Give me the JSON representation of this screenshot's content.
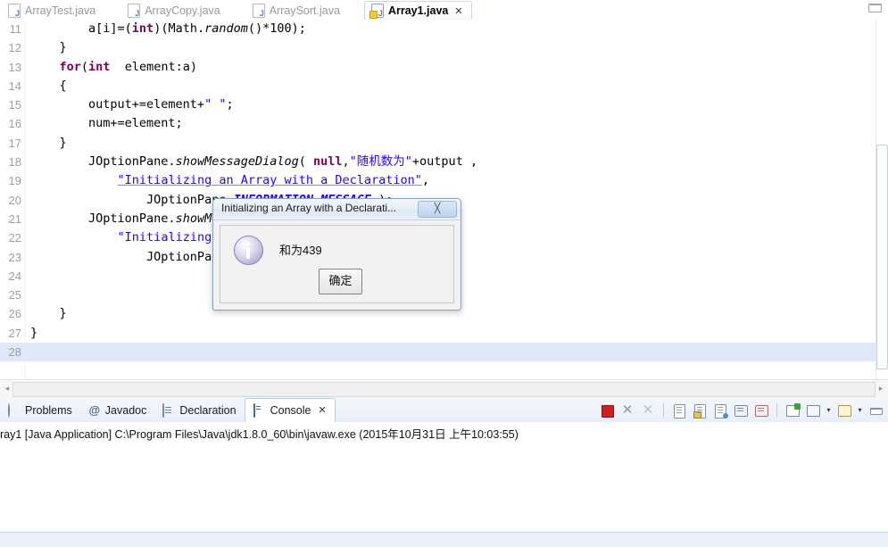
{
  "window": {
    "minimize_label": "minimize"
  },
  "editor_tabs": [
    {
      "label": "ArrayTest.java",
      "active": false
    },
    {
      "label": "ArrayCopy.java",
      "active": false
    },
    {
      "label": "ArraySort.java",
      "active": false
    },
    {
      "label": "Array1.java",
      "active": true,
      "close": "✕"
    }
  ],
  "code": {
    "lines": [
      {
        "num": "11",
        "highlight": false
      },
      {
        "num": "12",
        "highlight": false
      },
      {
        "num": "13",
        "highlight": false
      },
      {
        "num": "14",
        "highlight": false
      },
      {
        "num": "15",
        "highlight": false
      },
      {
        "num": "16",
        "highlight": false
      },
      {
        "num": "17",
        "highlight": false
      },
      {
        "num": "18",
        "highlight": false
      },
      {
        "num": "19",
        "highlight": false
      },
      {
        "num": "20",
        "highlight": false
      },
      {
        "num": "21",
        "highlight": false
      },
      {
        "num": "22",
        "highlight": false
      },
      {
        "num": "23",
        "highlight": false
      },
      {
        "num": "24",
        "highlight": false
      },
      {
        "num": "25",
        "highlight": false
      },
      {
        "num": "26",
        "highlight": false
      },
      {
        "num": "27",
        "highlight": false
      },
      {
        "num": "28",
        "highlight": true
      }
    ],
    "text": {
      "l11": "        a[i]=(int)(Math.random()*100);",
      "l12": "    }",
      "l13": "    for(int  element:a)",
      "l14": "    {",
      "l15": "        output+=element+\" \";",
      "l16": "        num+=element;",
      "l17": "    }",
      "l18": "        JOptionPane.showMessageDialog( null,\"随机数为\"+output ,",
      "l19": "            \"Initializing an Array with a Declaration\",",
      "l20": "                JOptionPane.INFORMATION_MESSAGE );",
      "l21": "        JOptionPane.showMessageDialog( null,\"和为\"+num ,",
      "l22": "            \"Initializing an Array with a Declaration\",",
      "l23": "                JOptionPane.INFORMATION_MESSAGE );",
      "l24": "",
      "l25": "",
      "l26": "    }",
      "l27": "}",
      "l28": ""
    },
    "tokens": {
      "kw_int": "int",
      "kw_for": "for",
      "kw_null": "null",
      "str_random": "\"随机数为\"",
      "str_sum": "\"和为\"",
      "str_title": "\"Initializing an Array with a Declaration\"",
      "const_msg": "INFORMATION_MESSAGE",
      "method_random": "random",
      "method_show": "showMessageDialog"
    }
  },
  "dialog": {
    "title": "Initializing an Array with a Declarati...",
    "close_glyph": "╳",
    "message": "和为439",
    "ok_label": "确定",
    "icon": "info-icon"
  },
  "bottom_tabs": [
    {
      "label": "Problems",
      "icon": "problems-icon",
      "active": false
    },
    {
      "label": "Javadoc",
      "icon": "javadoc-icon",
      "active": false
    },
    {
      "label": "Declaration",
      "icon": "declaration-icon",
      "active": false
    },
    {
      "label": "Console",
      "icon": "console-icon",
      "active": true,
      "close": "✕"
    }
  ],
  "console": {
    "status_line": "ray1 [Java Application] C:\\Program Files\\Java\\jdk1.8.0_60\\bin\\javaw.exe (2015年10月31日 上午10:03:55)",
    "toolbar": [
      {
        "name": "terminate-button",
        "glyph": ""
      },
      {
        "name": "remove-launch-button",
        "glyph": "✕"
      },
      {
        "name": "remove-all-terminated-button",
        "glyph": "✕"
      },
      {
        "name": "clear-console-button",
        "glyph": ""
      },
      {
        "name": "scroll-lock-button",
        "glyph": ""
      },
      {
        "name": "pin-console-button",
        "glyph": ""
      },
      {
        "name": "display-selected-console-button",
        "glyph": ""
      },
      {
        "name": "open-console-button",
        "glyph": ""
      },
      {
        "name": "new-console-view-button",
        "glyph": ""
      },
      {
        "name": "view-menu-button",
        "glyph": "▾"
      },
      {
        "name": "open-console-dropdown-button",
        "glyph": ""
      },
      {
        "name": "console-dropdown-arrow",
        "glyph": "▾"
      },
      {
        "name": "minimize-view-button",
        "glyph": ""
      }
    ]
  },
  "scroll": {
    "left_arrow": "◂",
    "right_arrow": "▸"
  },
  "colors": {
    "keyword": "#7f0055",
    "string": "#2a00ff",
    "selection": "#dde9f7",
    "stop_red": "#cf2020",
    "tab_border": "#c9d6e6"
  }
}
